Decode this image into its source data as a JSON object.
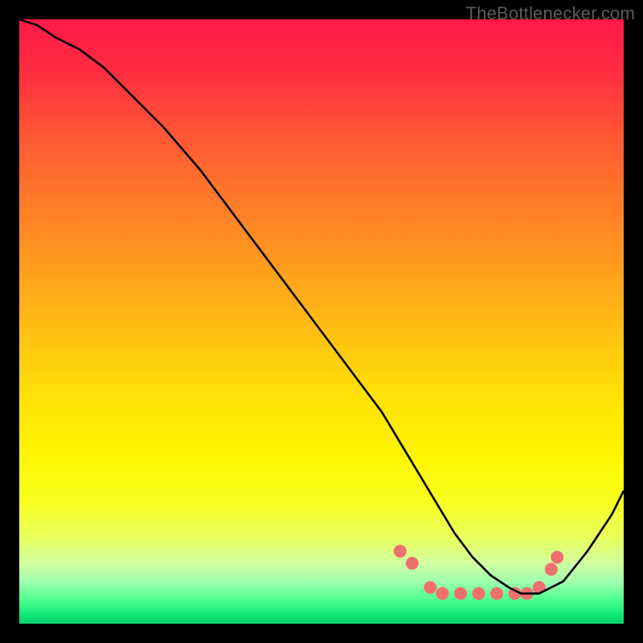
{
  "watermark": "TheBottlenecker.com",
  "chart_data": {
    "type": "line",
    "title": "",
    "xlabel": "",
    "ylabel": "",
    "xlim": [
      0,
      100
    ],
    "ylim": [
      0,
      100
    ],
    "grid": false,
    "gradient_stops": [
      {
        "offset": 0.0,
        "color": "#ff1a46"
      },
      {
        "offset": 0.08,
        "color": "#ff2a42"
      },
      {
        "offset": 0.2,
        "color": "#ff5a33"
      },
      {
        "offset": 0.35,
        "color": "#ff8a24"
      },
      {
        "offset": 0.5,
        "color": "#ffba15"
      },
      {
        "offset": 0.62,
        "color": "#ffe008"
      },
      {
        "offset": 0.72,
        "color": "#fff500"
      },
      {
        "offset": 0.8,
        "color": "#f8ff20"
      },
      {
        "offset": 0.86,
        "color": "#e8ff60"
      },
      {
        "offset": 0.9,
        "color": "#d0ffa0"
      },
      {
        "offset": 0.93,
        "color": "#a0ffb0"
      },
      {
        "offset": 0.96,
        "color": "#50ff90"
      },
      {
        "offset": 0.985,
        "color": "#10e878"
      },
      {
        "offset": 1.0,
        "color": "#08d070"
      }
    ],
    "series": [
      {
        "name": "bottleneck-curve",
        "color": "#000000",
        "x": [
          0,
          3,
          6,
          10,
          14,
          18,
          24,
          30,
          36,
          42,
          48,
          54,
          60,
          63,
          66,
          69,
          72,
          75,
          78,
          81,
          83,
          86,
          90,
          94,
          98,
          100
        ],
        "y": [
          100,
          99,
          97,
          95,
          92,
          88,
          82,
          75,
          67,
          59,
          51,
          43,
          35,
          30,
          25,
          20,
          15,
          11,
          8,
          6,
          5,
          5,
          7,
          12,
          18,
          22
        ]
      }
    ],
    "markers": {
      "name": "highlight-dots",
      "color": "#f07070",
      "radius": 8,
      "points": [
        {
          "x": 63,
          "y": 12
        },
        {
          "x": 65,
          "y": 10
        },
        {
          "x": 68,
          "y": 6
        },
        {
          "x": 70,
          "y": 5
        },
        {
          "x": 73,
          "y": 5
        },
        {
          "x": 76,
          "y": 5
        },
        {
          "x": 79,
          "y": 5
        },
        {
          "x": 82,
          "y": 5
        },
        {
          "x": 84,
          "y": 5
        },
        {
          "x": 86,
          "y": 6
        },
        {
          "x": 88,
          "y": 9
        },
        {
          "x": 89,
          "y": 11
        }
      ]
    }
  }
}
